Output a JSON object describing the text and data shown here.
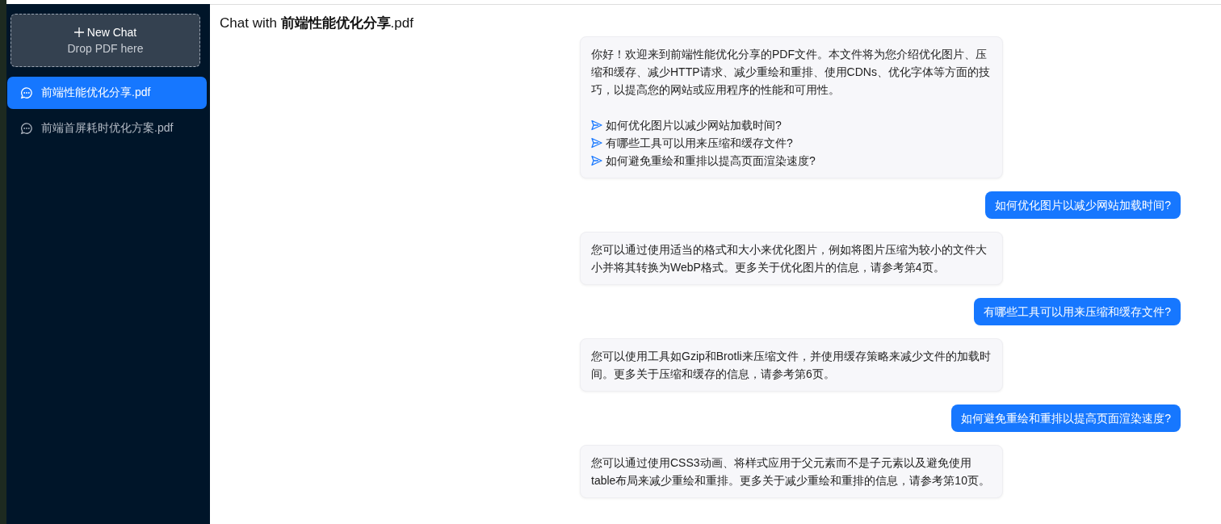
{
  "sidebar": {
    "new_chat": {
      "label": "New Chat",
      "hint": "Drop PDF here"
    },
    "items": [
      {
        "label": "前端性能优化分享.pdf",
        "selected": true
      },
      {
        "label": "前端首屏耗时优化方案.pdf",
        "selected": false
      }
    ]
  },
  "header": {
    "title": "Chat with **前端性能优化分享**.pdf"
  },
  "messages": [
    {
      "kind": "bot",
      "text": "你好！欢迎来到前端性能优化分享的PDF文件。本文件将为您介绍优化图片、压缩和缓存、减少HTTP请求、减少重绘和重排、使用CDNs、优化字体等方面的技巧，以提高您的网站或应用程序的性能和可用性。",
      "suggestions": [
        "如何优化图片以减少网站加载时间?",
        "有哪些工具可以用来压缩和缓存文件?",
        "如何避免重绘和重排以提高页面渲染速度?"
      ]
    },
    {
      "kind": "user",
      "text": "如何优化图片以减少网站加载时间?"
    },
    {
      "kind": "bot",
      "text": "您可以通过使用适当的格式和大小来优化图片，例如将图片压缩为较小的文件大小并将其转换为WebP格式。更多关于优化图片的信息，请参考第4页。"
    },
    {
      "kind": "user",
      "text": "有哪些工具可以用来压缩和缓存文件?"
    },
    {
      "kind": "bot",
      "text": "您可以使用工具如Gzip和Brotli来压缩文件，并使用缓存策略来减少文件的加载时间。更多关于压缩和缓存的信息，请参考第6页。"
    },
    {
      "kind": "user",
      "text": "如何避免重绘和重排以提高页面渲染速度?"
    },
    {
      "kind": "bot",
      "text": "您可以通过使用CSS3动画、将样式应用于父元素而不是子元素以及避免使用table布局来减少重绘和重排。更多关于减少重绘和重排的信息，请参考第10页。"
    }
  ]
}
